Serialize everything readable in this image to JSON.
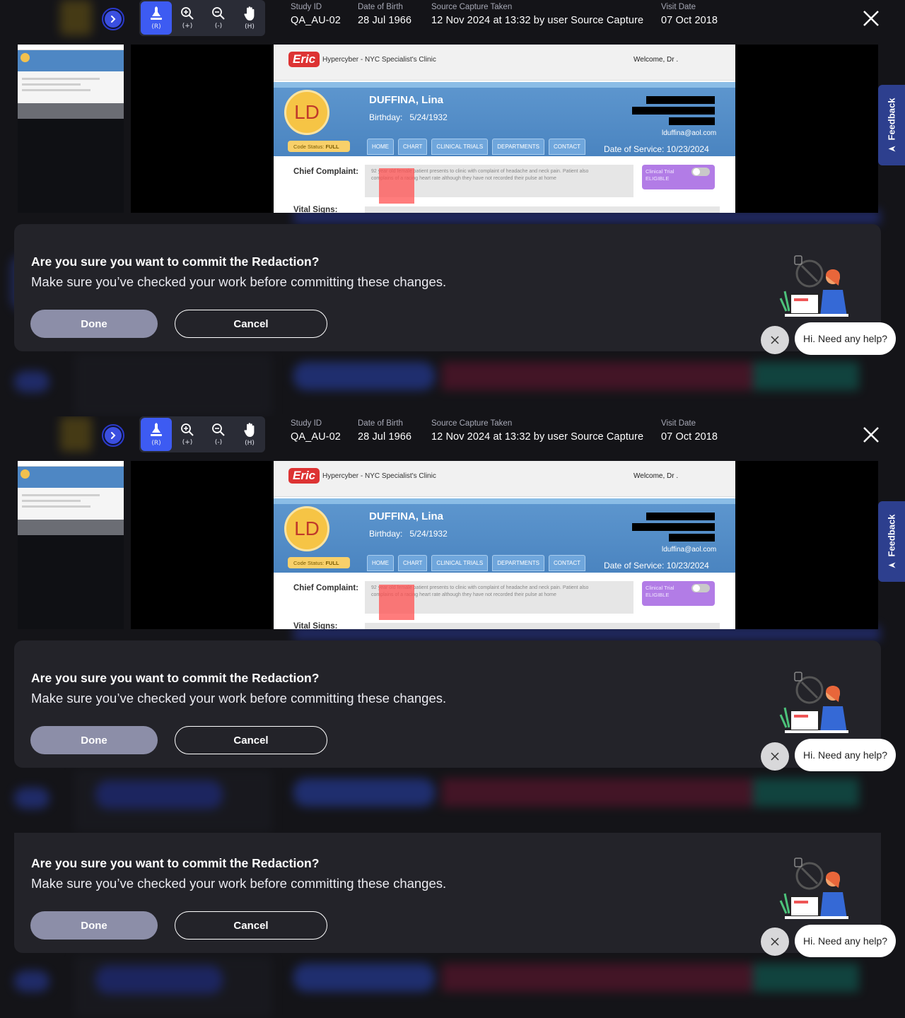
{
  "toolbar": {
    "tools": [
      {
        "label": "(R)",
        "icon": "redact-icon"
      },
      {
        "label": "(+)",
        "icon": "zoom-in-icon"
      },
      {
        "label": "(-)",
        "icon": "zoom-out-icon"
      },
      {
        "label": "(H)",
        "icon": "hand-pan-icon"
      }
    ]
  },
  "meta": {
    "study_id_label": "Study ID",
    "study_id": "QA_AU-02",
    "dob_label": "Date of Birth",
    "dob": "28 Jul 1966",
    "capture_label": "Source Capture Taken",
    "capture": "12 Nov 2024 at 13:32 by user Source Capture",
    "visit_label": "Visit Date",
    "visit": "07 Oct 2018"
  },
  "document": {
    "logo": "Eric",
    "clinic": "Hypercyber - NYC Specialist's Clinic",
    "welcome": "Welcome, Dr .",
    "initials": "LD",
    "patient_name": "DUFFINA, Lina",
    "birthday_label": "Birthday:",
    "birthday": "5/24/1932",
    "email": "lduffina@aol.com",
    "code_status_label": "Code Status:",
    "code_status": "FULL",
    "tabs": [
      "HOME",
      "CHART",
      "CLINICAL TRIALS",
      "DEPARTMENTS",
      "CONTACT"
    ],
    "date_of_service_label": "Date of Service:",
    "date_of_service": "10/23/2024",
    "chief_complaint_label": "Chief Complaint:",
    "chief_complaint": "92 year old female patient presents to clinic with complaint of headache and neck pain. Patient also complains of a racing heart rate although they have not recorded their pulse at home",
    "trial_label": "Clinical Trial",
    "trial_status": "ELIGIBLE",
    "vital_signs_label": "Vital Signs:"
  },
  "feedback": {
    "label": "Feedback"
  },
  "modal": {
    "title": "Are you sure you want to commit the Redaction?",
    "subtitle": "Make sure you’ve checked your work before committing these changes.",
    "done": "Done",
    "cancel": "Cancel"
  },
  "help": {
    "message": "Hi. Need any help?"
  },
  "colors": {
    "background": "#141418",
    "modal": "#232329",
    "accent": "#3d5bf2",
    "done_button": "#8c8ea8",
    "feedback_tab": "#2d3f8e"
  }
}
